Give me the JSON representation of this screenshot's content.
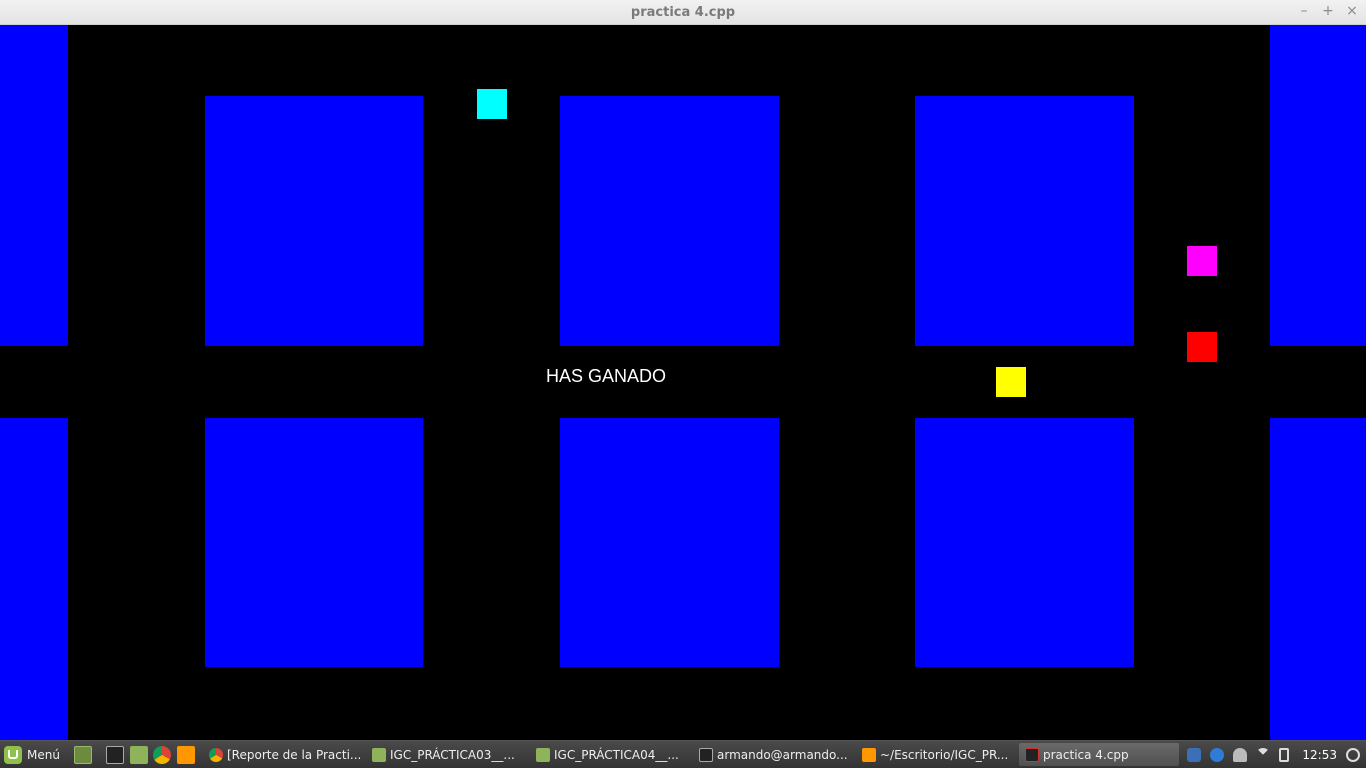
{
  "window": {
    "title": "practica 4.cpp",
    "controls": {
      "minimize": "–",
      "maximize": "+",
      "close": "×"
    }
  },
  "game": {
    "message": "HAS GANADO",
    "colors": {
      "background": "#000000",
      "wall": "#0000ff",
      "cyan_piece": "#00ffff",
      "magenta_piece": "#ff00ff",
      "red_piece": "#ff0000",
      "yellow_piece": "#ffff00"
    }
  },
  "taskbar": {
    "menu_label": "Menú",
    "tasks": [
      {
        "label": "[Reporte de la Practi...",
        "icon": "chrome-icon"
      },
      {
        "label": "IGC_PRÁCTICA03__...",
        "icon": "folder-icon"
      },
      {
        "label": "IGC_PRÁCTICA04__...",
        "icon": "folder-icon"
      },
      {
        "label": "armando@armando...",
        "icon": "terminal-icon"
      },
      {
        "label": "~/Escritorio/IGC_PR...",
        "icon": "sublime-icon"
      },
      {
        "label": "practica 4.cpp",
        "icon": "app-window-icon"
      }
    ],
    "clock": "12:53"
  }
}
